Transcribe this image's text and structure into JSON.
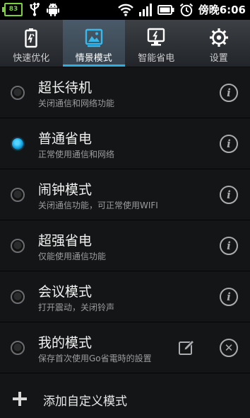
{
  "statusbar": {
    "battery_left_text": "83",
    "time": "傍晚6:06",
    "icons": [
      "battery-icon",
      "usb-icon",
      "android-icon",
      "wifi-icon",
      "signal-icon",
      "battery-icon",
      "alarm-icon"
    ]
  },
  "tabs": [
    {
      "label": "快速优化",
      "icon": "battery-optimize-icon",
      "active": false
    },
    {
      "label": "情景模式",
      "icon": "scene-mode-icon",
      "active": true
    },
    {
      "label": "智能省电",
      "icon": "smart-power-icon",
      "active": false
    },
    {
      "label": "设置",
      "icon": "gear-icon",
      "active": false
    }
  ],
  "modes": [
    {
      "title": "超长待机",
      "subtitle": "关闭通信和网络功能",
      "selected": false,
      "action": "info"
    },
    {
      "title": "普通省电",
      "subtitle": "正常使用通信和网络",
      "selected": true,
      "action": "info"
    },
    {
      "title": "闹钟模式",
      "subtitle": "关闭通信功能，可正常使用WIFI",
      "selected": false,
      "action": "info"
    },
    {
      "title": "超强省电",
      "subtitle": "仅能使用通信功能",
      "selected": false,
      "action": "info"
    },
    {
      "title": "会议模式",
      "subtitle": "打开震动，关闭铃声",
      "selected": false,
      "action": "info"
    },
    {
      "title": "我的模式",
      "subtitle": "保存首次使用Go省電時的設置",
      "selected": false,
      "action": "edit-delete"
    }
  ],
  "add_mode": {
    "label": "添加自定义模式"
  },
  "colors": {
    "accent": "#2bb0e4",
    "background": "#141517",
    "tabbar": "#2d3034"
  }
}
